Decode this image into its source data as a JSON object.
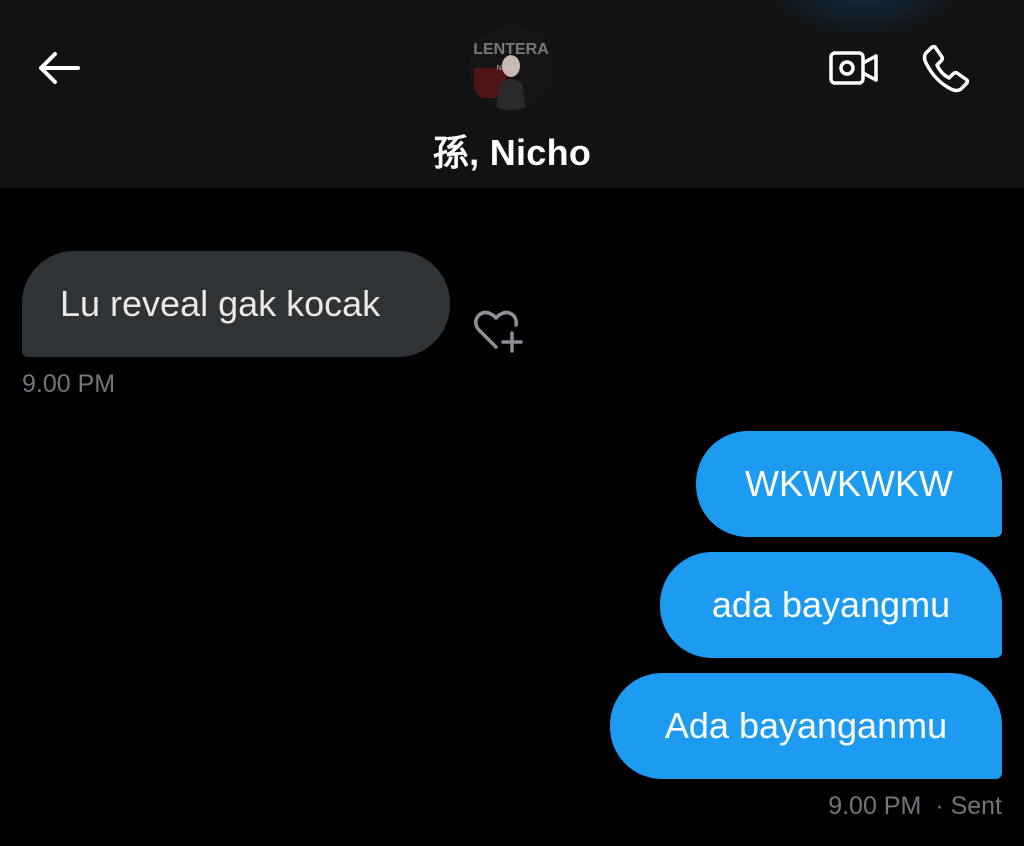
{
  "header": {
    "contact_name": "孫, Nicho",
    "avatar_text_top": "LENTERA",
    "avatar_text_mid": "NICHO"
  },
  "icons": {
    "back": "back-arrow-icon",
    "video": "video-call-icon",
    "call": "phone-icon",
    "like": "heart-plus-icon"
  },
  "messages": [
    {
      "direction": "received",
      "text": "Lu reveal gak kocak",
      "time": "9.00 PM"
    },
    {
      "direction": "sent",
      "text": "WKWKWKW"
    },
    {
      "direction": "sent",
      "text": "ada bayangmu"
    },
    {
      "direction": "sent",
      "text": "Ada bayanganmu",
      "time": "9.00 PM",
      "status": "· Sent"
    }
  ],
  "colors": {
    "sent_bubble": "#1d9bf0",
    "received_bubble": "#2f3336",
    "background": "#000000",
    "header_bg": "#111213",
    "meta_text": "#71767b"
  }
}
